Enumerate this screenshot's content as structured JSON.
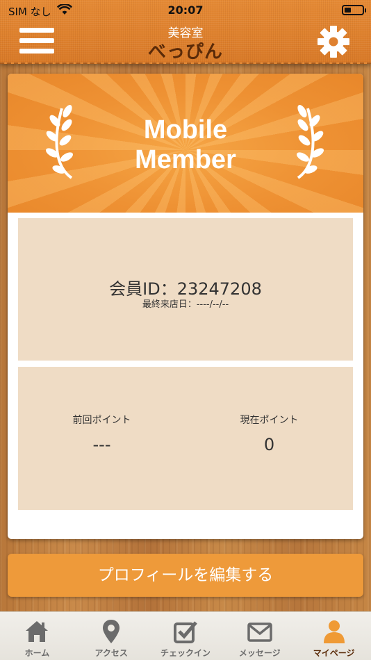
{
  "status_bar": {
    "carrier": "SIM なし",
    "time": "20:07"
  },
  "header": {
    "subtitle": "美容室",
    "title": "べっぴん"
  },
  "card": {
    "banner_line1": "Mobile",
    "banner_line2": "Member",
    "member_id": "会員ID：23247208",
    "last_visit": "最終来店日：----/--/--",
    "previous_points_label": "前回ポイント",
    "previous_points_value": "---",
    "current_points_label": "現在ポイント",
    "current_points_value": "0"
  },
  "edit_profile_label": "プロフィールを編集する",
  "tabs": [
    {
      "label": "ホーム",
      "icon": "home-icon",
      "active": false
    },
    {
      "label": "アクセス",
      "icon": "map-pin-icon",
      "active": false
    },
    {
      "label": "チェックイン",
      "icon": "checkbox-icon",
      "active": false
    },
    {
      "label": "メッセージ",
      "icon": "envelope-icon",
      "active": false
    },
    {
      "label": "マイページ",
      "icon": "user-icon",
      "active": true
    }
  ],
  "colors": {
    "accent": "#ee9a3a",
    "header": "#df8130",
    "panel": "#efdcc5",
    "active_tab_icon": "#ef9a35",
    "inactive_tab_icon": "#6b6b6b"
  }
}
